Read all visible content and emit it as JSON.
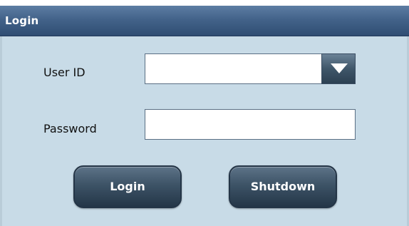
{
  "window": {
    "title": "Login"
  },
  "form": {
    "user_id_label": "User ID",
    "user_id_value": "",
    "password_label": "Password",
    "password_value": ""
  },
  "buttons": {
    "login_label": "Login",
    "shutdown_label": "Shutdown"
  },
  "icons": {
    "dropdown": "chevron-down-icon"
  },
  "colors": {
    "titlebar": "#43638a",
    "panel_background": "#c8dbe7",
    "button": "#3d5366"
  }
}
